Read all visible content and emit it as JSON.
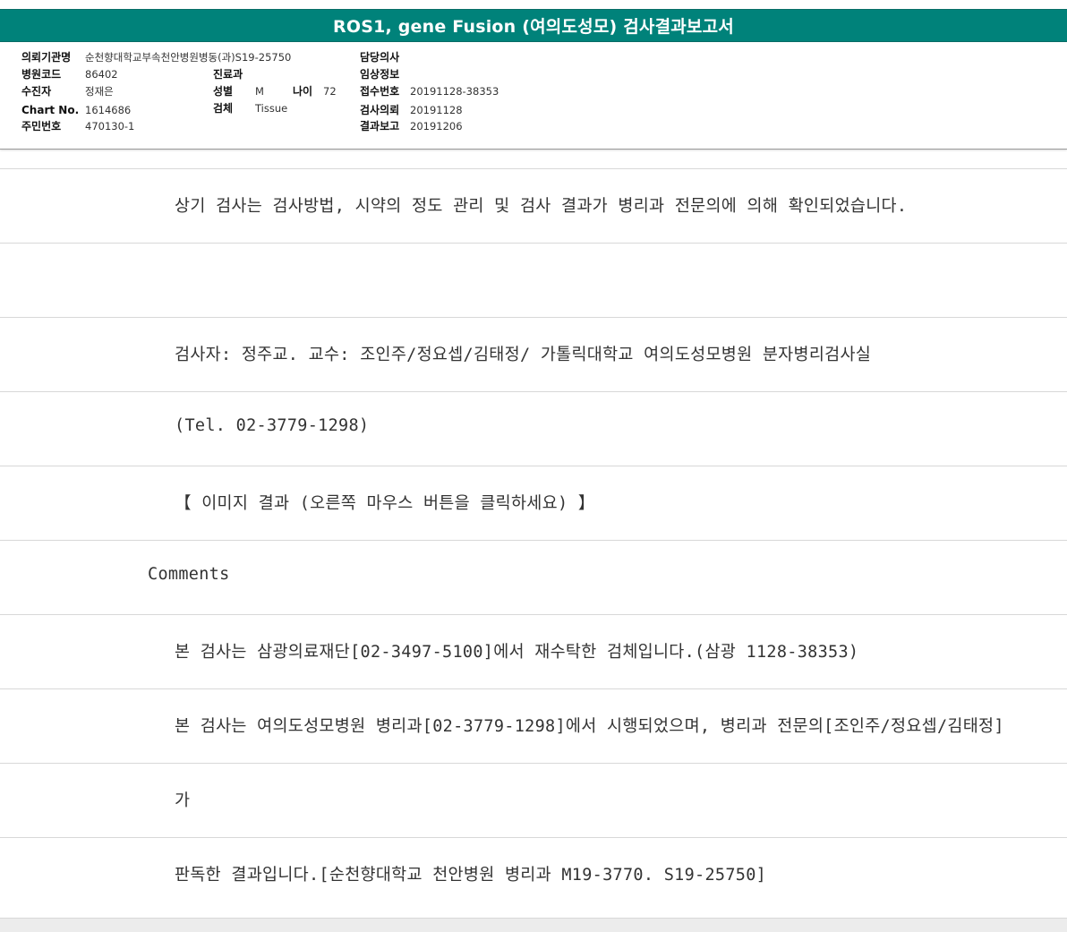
{
  "header": {
    "title": "ROS1, gene Fusion (여의도성모) 검사결과보고서",
    "accent_color": "#00827a"
  },
  "patient": {
    "institution": {
      "label": "의뢰기관명",
      "value": "순천향대학교부속천안병원병동(과)S19-25750"
    },
    "hospital_code": {
      "label": "병원코드",
      "value": "86402"
    },
    "examinee": {
      "label": "수진자",
      "value": "정재은"
    },
    "chart_no": {
      "label": "Chart No.",
      "value": "1614686"
    },
    "resident_no": {
      "label": "주민번호",
      "value": "470130-1"
    },
    "department": {
      "label": "진료과",
      "value": ""
    },
    "sex": {
      "label": "성별",
      "value": "M"
    },
    "age": {
      "label": "나이",
      "value": "72"
    },
    "specimen": {
      "label": "검체",
      "value": "Tissue"
    },
    "doctor": {
      "label": "담당의사",
      "value": ""
    },
    "clinical_info": {
      "label": "임상정보",
      "value": ""
    },
    "receipt_no": {
      "label": "접수번호",
      "value": "20191128-38353"
    },
    "request_date": {
      "label": "검사의뢰",
      "value": "20191128"
    },
    "report_date": {
      "label": "결과보고",
      "value": "20191206"
    }
  },
  "report": {
    "lines": [
      "상기 검사는 검사방법, 시약의 정도 관리 및 검사 결과가 병리과 전문의에 의해 확인되었습니다.",
      "",
      "검사자: 정주교. 교수: 조인주/정요셉/김태정/ 가톨릭대학교 여의도성모병원 분자병리검사실",
      "(Tel. 02-3779-1298)",
      "【 이미지 결과 (오른쪽 마우스 버튼을 클릭하세요) 】",
      "Comments",
      "본 검사는 삼광의료재단[02-3497-5100]에서 재수탁한 검체입니다.(삼광 1128-38353)",
      "본 검사는 여의도성모병원 병리과[02-3779-1298]에서 시행되었으며, 병리과 전문의[조인주/정요셉/김태정]",
      "가",
      "판독한 결과입니다.[순천향대학교 천안병원 병리과 M19-3770. S19-25750]"
    ]
  }
}
